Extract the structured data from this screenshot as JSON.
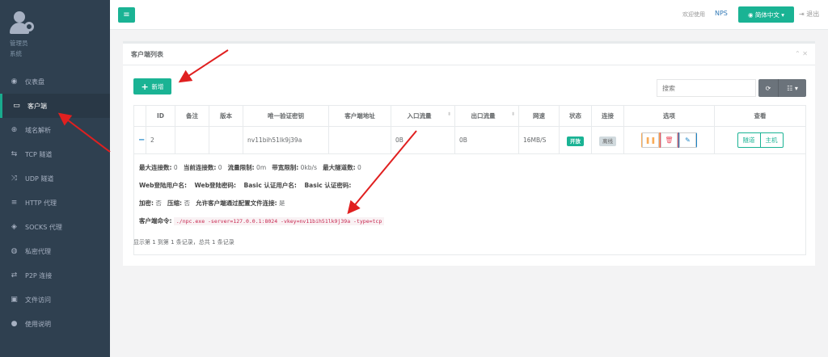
{
  "sidebar": {
    "profile": {
      "name": "管理员",
      "role": "系统"
    },
    "items": [
      {
        "label": "仪表盘",
        "icon": "dashboard-icon",
        "glyph": "◉"
      },
      {
        "label": "客户端",
        "icon": "monitor-icon",
        "glyph": "▭",
        "active": true
      },
      {
        "label": "域名解析",
        "icon": "globe-icon",
        "glyph": "⊕"
      },
      {
        "label": "TCP 隧道",
        "icon": "retweet-icon",
        "glyph": "⇆"
      },
      {
        "label": "UDP 隧道",
        "icon": "random-icon",
        "glyph": "⤨"
      },
      {
        "label": "HTTP 代理",
        "icon": "server-icon",
        "glyph": "≡"
      },
      {
        "label": "SOCKS 代理",
        "icon": "layers-icon",
        "glyph": "◈"
      },
      {
        "label": "私密代理",
        "icon": "eye-slash-icon",
        "glyph": "◍"
      },
      {
        "label": "P2P 连接",
        "icon": "exchange-icon",
        "glyph": "⇄"
      },
      {
        "label": "文件访问",
        "icon": "briefcase-icon",
        "glyph": "▣"
      },
      {
        "label": "使用说明",
        "icon": "lightbulb-icon",
        "glyph": "●"
      }
    ]
  },
  "topbar": {
    "menu_glyph": "≡",
    "welcome": "欢迎使用",
    "app_name": "NPS",
    "language": "简体中文",
    "logout": "退出"
  },
  "panel": {
    "title": "客户端列表",
    "tools": "⌃ ✕",
    "add_label": "新增",
    "search_placeholder": "搜索",
    "refresh_glyph": "⟳",
    "columns_glyph": "☷ ▾",
    "columns": [
      "",
      "ID",
      "备注",
      "版本",
      "唯一验证密钥",
      "客户端地址",
      "入口流量",
      "出口流量",
      "网速",
      "状态",
      "连接",
      "选项",
      "查看"
    ],
    "row": {
      "expand": "−",
      "id": "2",
      "remark": "",
      "version": "",
      "vkey": "nv11bih51lk9j39a",
      "address": "",
      "inflow": "0B",
      "outflow": "0B",
      "speed": "16MB/S",
      "status": "开放",
      "connection": "离线",
      "view_tunnel": "隧道",
      "view_host": "主机"
    },
    "detail": {
      "max_conn_label": "最大连接数:",
      "max_conn": "0",
      "cur_conn_label": "当前连接数:",
      "cur_conn": "0",
      "flow_limit_label": "流量限制:",
      "flow_limit": "0m",
      "rate_limit_label": "带宽限制:",
      "rate_limit": "0kb/s",
      "max_tunnel_label": "最大隧道数:",
      "max_tunnel": "0",
      "web_user_label": "Web登陆用户名:",
      "web_pass_label": "Web登陆密码:",
      "basic_user_label": "Basic 认证用户名:",
      "basic_pass_label": "Basic 认证密码:",
      "crypt_label": "加密:",
      "crypt": "否",
      "compress_label": "压缩:",
      "compress": "否",
      "config_conn_label": "允许客户端通过配置文件连接:",
      "config_conn": "是",
      "cmd_label": "客户端命令:",
      "cmd": "./npc.exe -server=127.0.0.1:8024 -vkey=nv11bih51lk9j39a -type=tcp"
    },
    "footer": "显示第 1 到第 1 条记录，总共 1 条记录"
  },
  "colors": {
    "accent": "#1ab394",
    "sidebar": "#2f4050",
    "annotation_arrow": "#e02020"
  }
}
